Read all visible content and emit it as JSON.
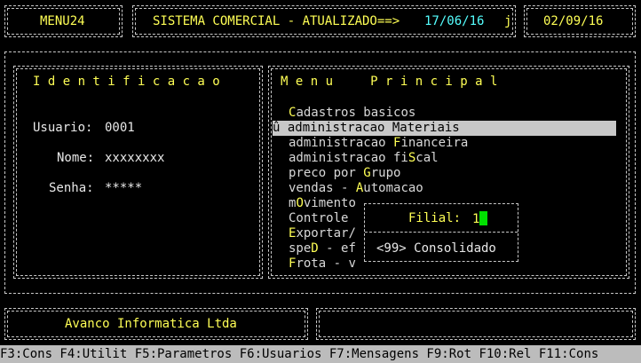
{
  "header": {
    "menu_code": "MENU24",
    "system_title": "SISTEMA COMERCIAL - ATUALIZADO==>",
    "updated_date": "17/06/16",
    "flag": "j",
    "current_date": "02/09/16"
  },
  "identification": {
    "title": "I d e n t i f i c a c a o",
    "user_label": "Usuario:",
    "user_value": "0001",
    "name_label": "Nome:",
    "name_value": "xxxxxxxx",
    "password_label": "Senha:",
    "password_value": "*****"
  },
  "main_menu": {
    "title": "M e n u     P r i n c i p a l",
    "selected_marker": "û",
    "items": [
      {
        "hotkey": "C",
        "rest": "adastros basicos"
      },
      {
        "pre": "",
        "hotkey": "",
        "rest": "administracao Materiais",
        "mid_hotkey": "M"
      },
      {
        "pre": "administracao ",
        "hotkey": "F",
        "rest": "inanceira"
      },
      {
        "pre": "administracao fi",
        "hotkey": "S",
        "rest": "cal"
      },
      {
        "pre": "preco por ",
        "hotkey": "G",
        "rest": "rupo"
      },
      {
        "pre": "vendas - ",
        "hotkey": "A",
        "rest": "utomacao"
      },
      {
        "pre": "m",
        "hotkey": "O",
        "rest": "vimento"
      },
      {
        "pre": "Controle",
        "hotkey": "",
        "rest": ""
      },
      {
        "pre": "",
        "hotkey": "E",
        "rest": "xportar/"
      },
      {
        "pre": "spe",
        "hotkey": "D",
        "rest": " - ef"
      },
      {
        "pre": "",
        "hotkey": "F",
        "rest": "rota - v"
      }
    ]
  },
  "filial_popup": {
    "label": "Filial:",
    "value": "1",
    "option": "<99> Consolidado"
  },
  "footer": {
    "company": "Avanco Informatica Ltda",
    "status": ""
  },
  "function_keys": "F3:Cons F4:Utilit F5:Parametros F6:Usuarios F7:Mensagens F9:Rot F10:Rel F11:Cons"
}
